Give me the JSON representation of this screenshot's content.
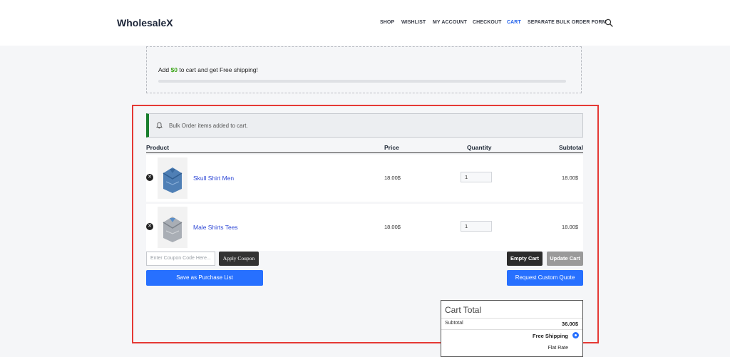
{
  "header": {
    "logo": "WholesaleX",
    "nav": [
      {
        "label": "SHOP",
        "active": false
      },
      {
        "label": "WISHLIST",
        "active": false
      },
      {
        "label": "MY ACCOUNT",
        "active": false
      },
      {
        "label": "CHECKOUT",
        "active": false
      },
      {
        "label": "CART",
        "active": true
      },
      {
        "label": "SEPARATE BULK ORDER FORM",
        "active": false
      }
    ],
    "search_icon": "search-icon"
  },
  "shipping": {
    "prefix": "Add ",
    "amount": "$0",
    "suffix": " to cart and get Free shipping!",
    "progress": 0
  },
  "notice": {
    "icon": "bell-icon",
    "text": "Bulk Order items added to cart."
  },
  "table": {
    "headers": {
      "product": "Product",
      "price": "Price",
      "quantity": "Quantity",
      "subtotal": "Subtotal"
    },
    "rows": [
      {
        "name": "Skull Shirt Men",
        "price": "18.00$",
        "quantity": "1",
        "subtotal": "18.00$"
      },
      {
        "name": "Male Shirts Tees",
        "price": "18.00$",
        "quantity": "1",
        "subtotal": "18.00$"
      }
    ]
  },
  "actions": {
    "coupon_placeholder": "Enter Coupon Code Here...",
    "apply_coupon": "Apply Coupon",
    "empty_cart": "Empty Cart",
    "update_cart": "Update Cart",
    "save_purchase_list": "Save as Purchase List",
    "request_quote": "Request Custom Quote"
  },
  "cart_total": {
    "title": "Cart Total",
    "subtotal_label": "Subtotal",
    "subtotal_value": "36.00$",
    "free_shipping": "Free Shipping",
    "flat_rate": "Flat Rate"
  },
  "colors": {
    "accent": "#2770ff",
    "active_nav": "#2563eb",
    "success": "#1a7f2e",
    "highlight_frame": "#e53935"
  }
}
